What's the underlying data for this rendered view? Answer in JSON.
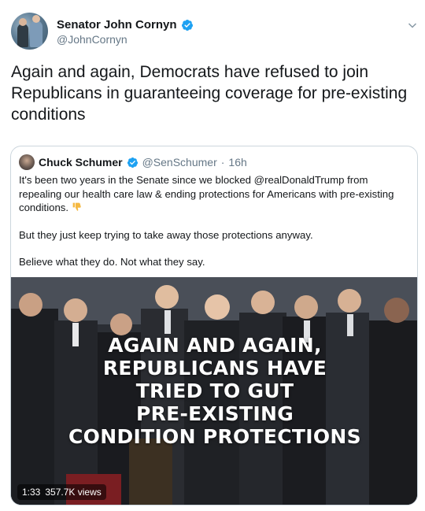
{
  "author": {
    "display_name": "Senator John Cornyn",
    "handle": "@JohnCornyn",
    "verified": true
  },
  "tweet": {
    "text": "Again and again, Democrats have refused to join Republicans in guaranteeing coverage for pre-existing conditions"
  },
  "quoted_tweet": {
    "author": {
      "display_name": "Chuck Schumer",
      "handle": "@SenSchumer",
      "separator": "·",
      "time": "16h",
      "verified": true
    },
    "paragraphs": [
      "It's been two years in the Senate since we blocked @realDonaldTrump from repealing our health care law & ending protections for Americans with pre-existing conditions.",
      "But they just keep trying to take away those protections anyway.",
      "Believe what they do. Not what they say."
    ],
    "video": {
      "overlay_lines": [
        "AGAIN AND AGAIN,",
        "REPUBLICANS HAVE",
        "TRIED TO GUT",
        "PRE-EXISTING",
        "CONDITION PROTECTIONS"
      ],
      "duration": "1:33",
      "views": "357.7K views"
    }
  },
  "colors": {
    "verified_blue": "#1da1f2",
    "secondary_text": "#657786",
    "border": "#ccd6dd"
  },
  "icons": {
    "verified": "verified-badge-icon",
    "caret": "chevron-down-icon",
    "thumbs_down": "thumbs-down-emoji-icon"
  }
}
